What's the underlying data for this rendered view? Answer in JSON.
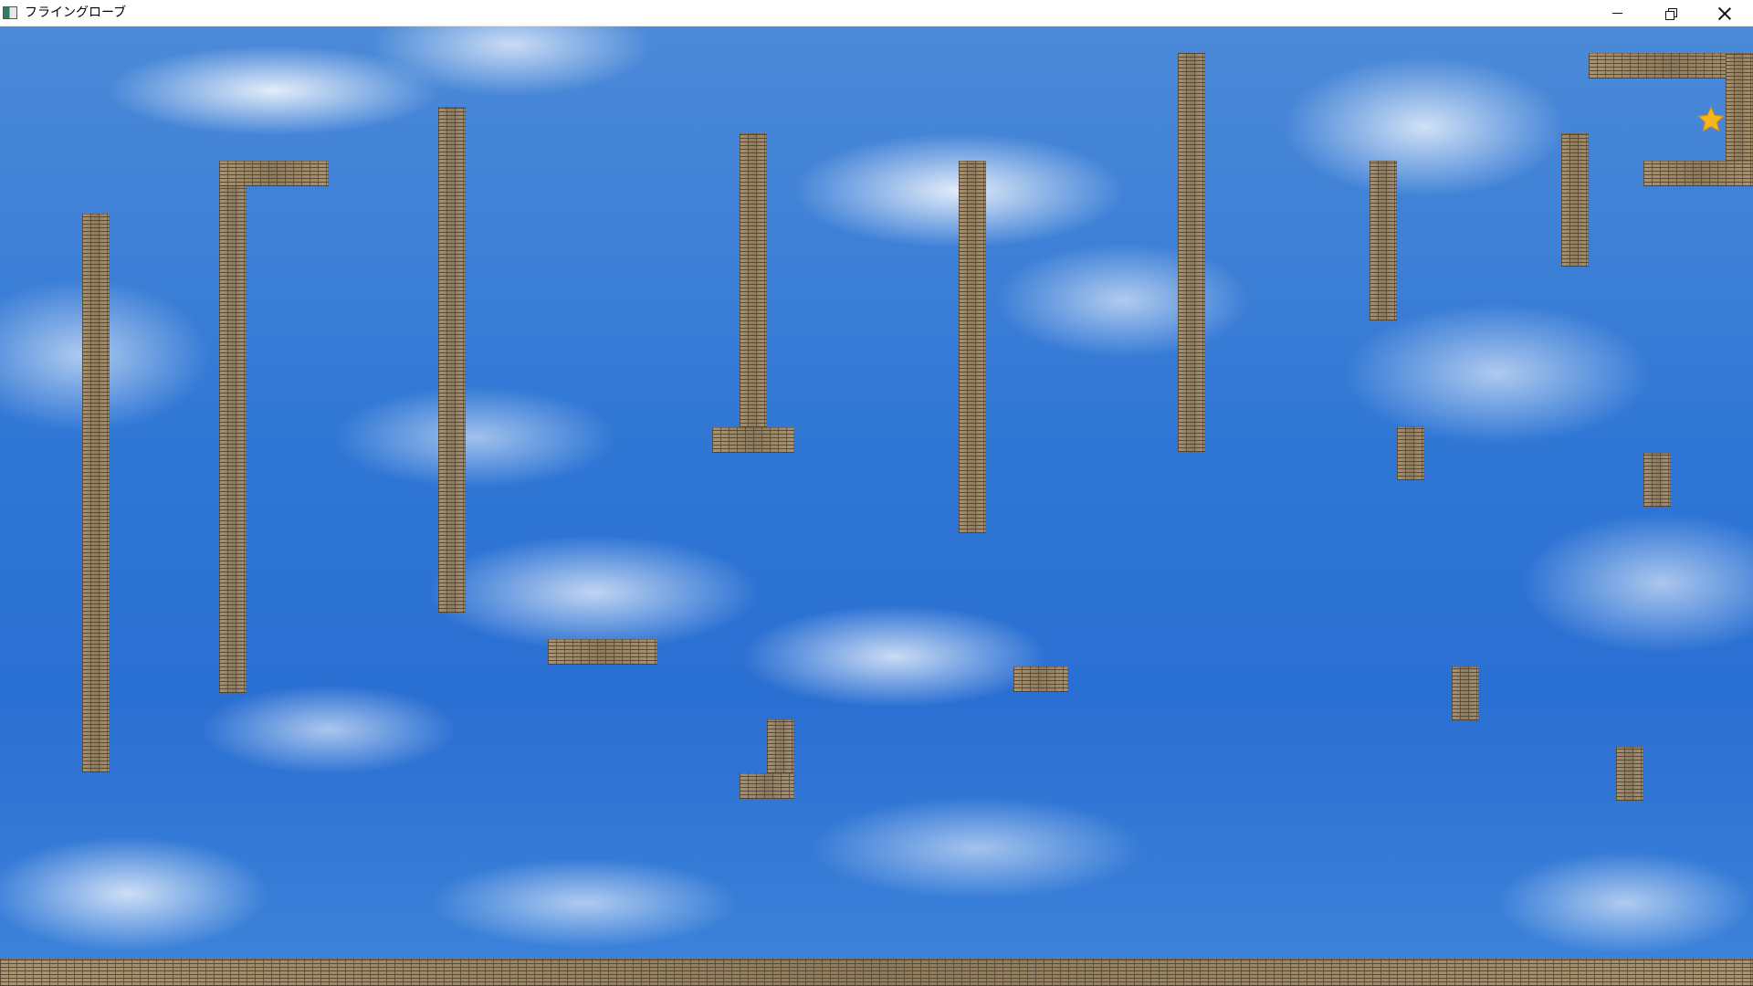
{
  "window": {
    "title": "フライングローブ",
    "icons": {
      "app": "app-window-icon",
      "minimize": "minimize-icon",
      "maximize": "restore-icon",
      "close": "close-icon"
    }
  },
  "game": {
    "background": "sky-with-clouds",
    "colors": {
      "sky": "#2f76d5",
      "brick": "#9b8a6d",
      "star": "#f5b51c"
    },
    "goal": "star-icon"
  }
}
